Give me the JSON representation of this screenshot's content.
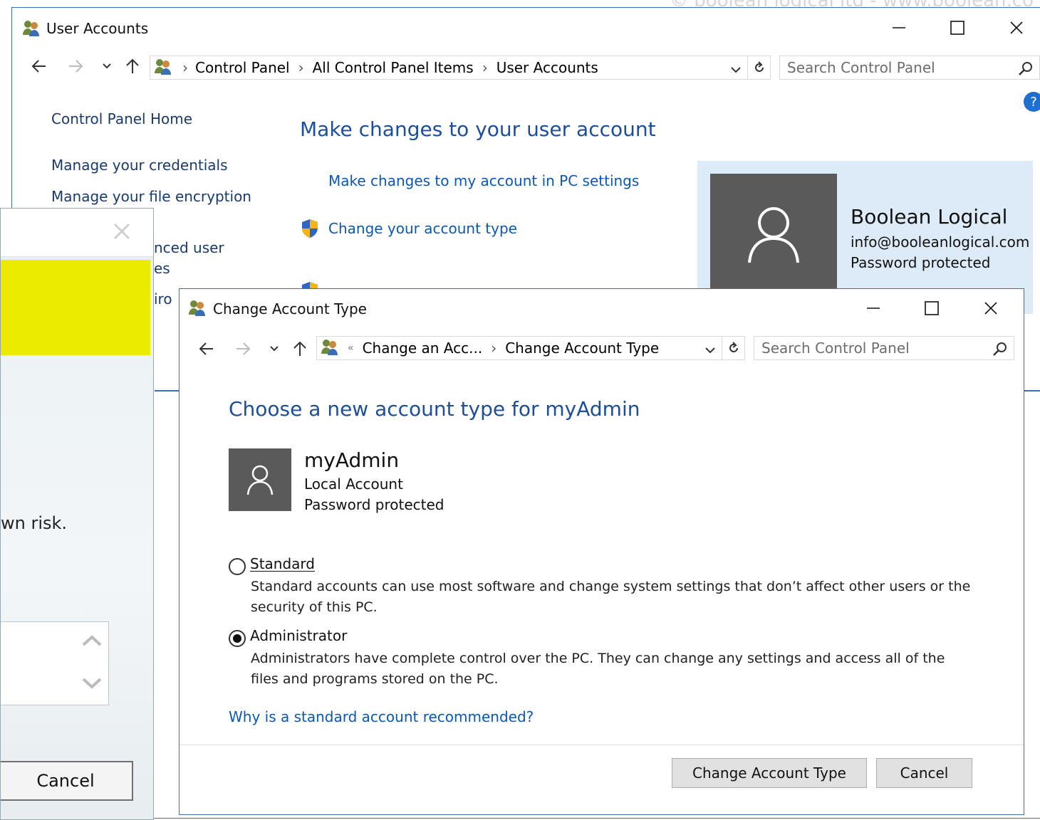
{
  "watermark": "© boolean logical ltd - www.boolean.co",
  "main": {
    "title": "User Accounts",
    "breadcrumb": [
      "Control Panel",
      "All Control Panel Items",
      "User Accounts"
    ],
    "search_placeholder": "Search Control Panel",
    "help": "?",
    "sidebar": {
      "home": "Control Panel Home",
      "items": [
        "Manage your credentials",
        "Manage your file encryption"
      ],
      "partial": [
        "nced user",
        "es",
        "iro"
      ]
    },
    "heading": "Make changes to your user account",
    "links": {
      "pc_settings": "Make changes to my account in PC settings",
      "change_type": "Change your account type"
    },
    "account": {
      "name": "Boolean Logical",
      "email": "info@booleanlogical.com",
      "status": "Password protected"
    }
  },
  "legacy": {
    "text": "wn risk.",
    "cancel": "Cancel"
  },
  "dialog": {
    "title": "Change Account Type",
    "breadcrumb": [
      "Change an Acc...",
      "Change Account Type"
    ],
    "search_placeholder": "Search Control Panel",
    "heading": "Choose a new account type for myAdmin",
    "user": {
      "name": "myAdmin",
      "type": "Local Account",
      "status": "Password protected"
    },
    "options": [
      {
        "label": "Standard",
        "checked": false,
        "desc_line1": "Standard accounts can use most software and change system settings that don’t affect other users or the",
        "desc_line2": "security of this PC."
      },
      {
        "label": "Administrator",
        "checked": true,
        "desc_line1": "Administrators have complete control over the PC. They can change any settings and access all of the",
        "desc_line2": "files and programs stored on the PC."
      }
    ],
    "why_link": "Why is a standard account recommended?",
    "buttons": {
      "ok": "Change Account Type",
      "cancel": "Cancel"
    }
  }
}
